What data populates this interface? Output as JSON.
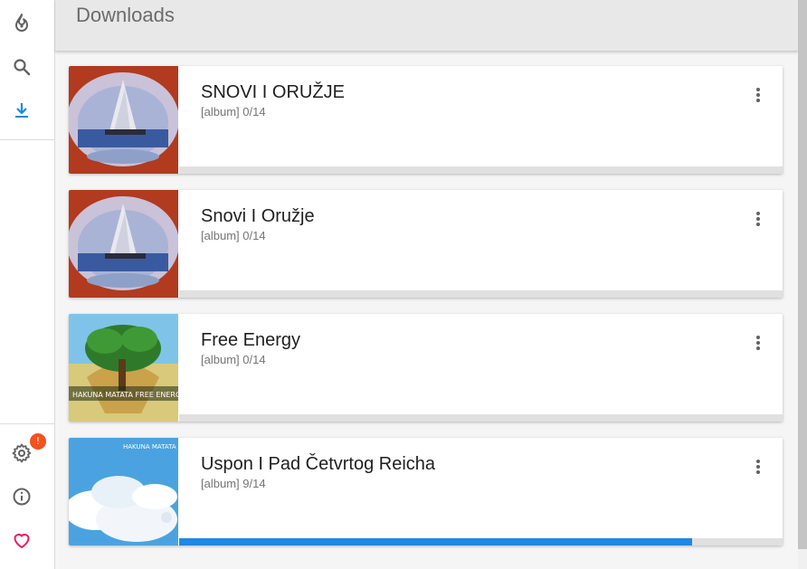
{
  "header": {
    "title": "Downloads"
  },
  "sidebar": {
    "top_items": [
      {
        "icon": "trending-fire-icon",
        "active": false
      },
      {
        "icon": "search-icon",
        "active": false
      },
      {
        "icon": "download-icon",
        "active": true
      }
    ],
    "bottom_items": [
      {
        "icon": "settings-gear-icon",
        "badge": "!"
      },
      {
        "icon": "info-icon"
      },
      {
        "icon": "heart-icon"
      }
    ]
  },
  "colors": {
    "accent": "#1e88e5",
    "badge": "#f4511e",
    "heart": "#e91e63",
    "icon": "#616161"
  },
  "downloads": [
    {
      "title": "SNOVI I ORUŽJE",
      "subtitle": "[album] 0/14",
      "progress": 0.0,
      "cover": "ship-cover"
    },
    {
      "title": "Snovi I Oružje",
      "subtitle": "[album] 0/14",
      "progress": 0.0,
      "cover": "ship-cover"
    },
    {
      "title": "Free Energy",
      "subtitle": "[album] 0/14",
      "progress": 0.0,
      "cover": "tree-cover",
      "cover_text": "HAKUNA MATATA FREE ENERGY"
    },
    {
      "title": "Uspon I Pad Četvrtog Reicha",
      "subtitle": "[album] 9/14",
      "progress": 0.85,
      "cover": "clouds-cover",
      "cover_text": "HAKUNA MATATA"
    }
  ]
}
